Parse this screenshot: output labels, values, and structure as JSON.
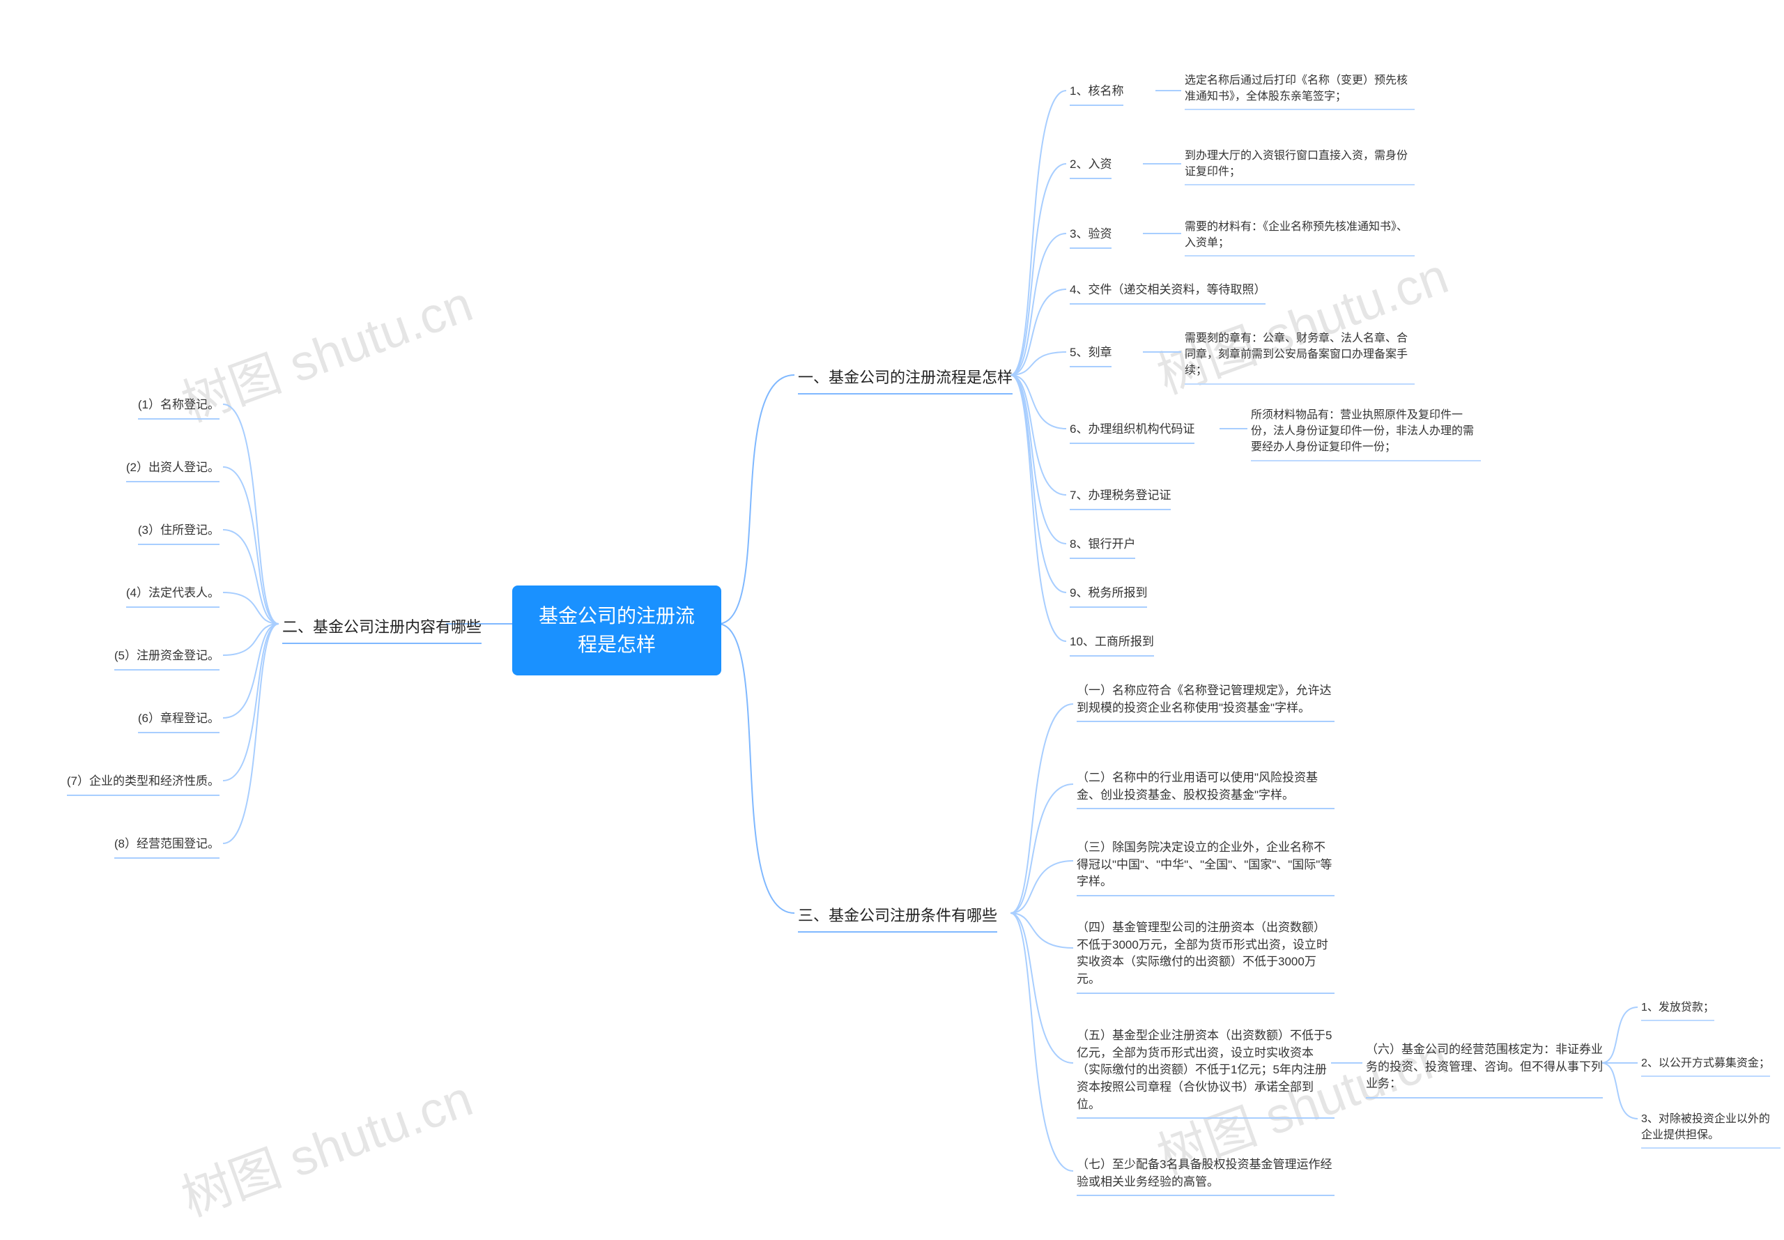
{
  "root": {
    "title": "基金公司的注册流程是怎样"
  },
  "branches": {
    "b1": {
      "label": "一、基金公司的注册流程是怎样"
    },
    "b2": {
      "label": "二、基金公司注册内容有哪些"
    },
    "b3": {
      "label": "三、基金公司注册条件有哪些"
    }
  },
  "b1_items": {
    "n1": {
      "label": "1、核名称",
      "desc": "选定名称后通过后打印《名称（变更）预先核准通知书》，全体股东亲笔签字；"
    },
    "n2": {
      "label": "2、入资",
      "desc": "到办理大厅的入资银行窗口直接入资，需身份证复印件；"
    },
    "n3": {
      "label": "3、验资",
      "desc": "需要的材料有：《企业名称预先核准通知书》、入资单；"
    },
    "n4": {
      "label": "4、交件（递交相关资料，等待取照）"
    },
    "n5": {
      "label": "5、刻章",
      "desc": "需要刻的章有：公章、财务章、法人名章、合同章，刻章前需到公安局备案窗口办理备案手续；"
    },
    "n6": {
      "label": "6、办理组织机构代码证",
      "desc": "所须材料物品有：营业执照原件及复印件一份，法人身份证复印件一份，非法人办理的需要经办人身份证复印件一份；"
    },
    "n7": {
      "label": "7、办理税务登记证"
    },
    "n8": {
      "label": "8、银行开户"
    },
    "n9": {
      "label": "9、税务所报到"
    },
    "n10": {
      "label": "10、工商所报到"
    }
  },
  "b2_items": {
    "n1": "(1）名称登记。",
    "n2": "(2）出资人登记。",
    "n3": "(3）住所登记。",
    "n4": "(4）法定代表人。",
    "n5": "(5）注册资金登记。",
    "n6": "(6）章程登记。",
    "n7": "(7）企业的类型和经济性质。",
    "n8": "(8）经营范围登记。"
  },
  "b3_items": {
    "n1": "（一）名称应符合《名称登记管理规定》，允许达到规模的投资企业名称使用\"投资基金\"字样。",
    "n2": "（二）名称中的行业用语可以使用\"风险投资基金、创业投资基金、股权投资基金\"字样。",
    "n3": "（三）除国务院决定设立的企业外，企业名称不得冠以\"中国\"、\"中华\"、\"全国\"、\"国家\"、\"国际\"等字样。",
    "n4": "（四）基金管理型公司的注册资本（出资数额）不低于3000万元，全部为货币形式出资，设立时实收资本（实际缴付的出资额）不低于3000万元。",
    "n5": "（五）基金型企业注册资本（出资数额）不低于5亿元，全部为货币形式出资，设立时实收资本（实际缴付的出资额）不低于1亿元；5年内注册资本按照公司章程（合伙协议书）承诺全部到位。",
    "n6": "（六）基金公司的经营范围核定为：非证券业务的投资、投资管理、咨询。但不得从事下列业务：",
    "n7": "（七）至少配备3名具备股权投资基金管理运作经验或相关业务经验的高管。"
  },
  "b3_n6_sub": {
    "s1": "1、发放贷款；",
    "s2": "2、以公开方式募集资金；",
    "s3": "3、对除被投资企业以外的企业提供担保。"
  },
  "watermark": "树图 shutu.cn"
}
